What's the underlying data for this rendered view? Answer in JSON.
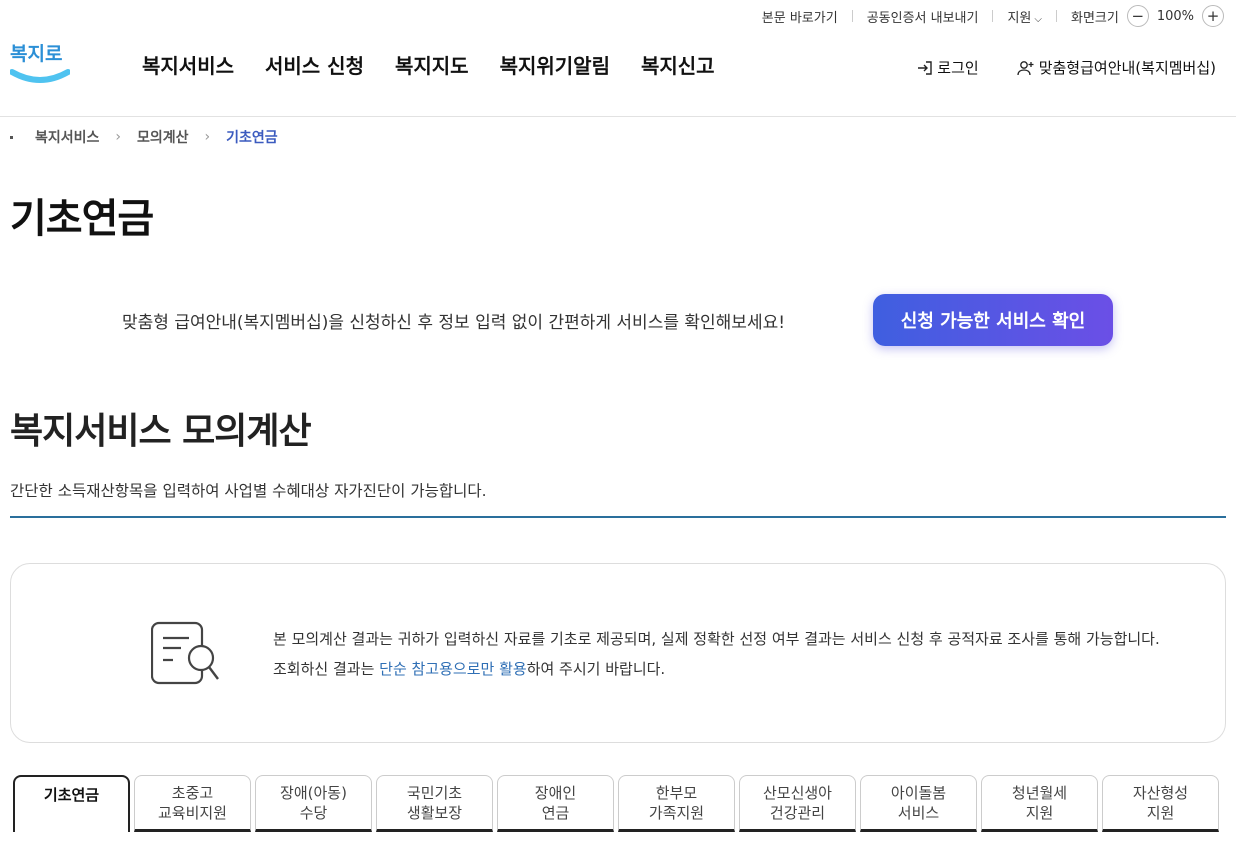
{
  "util": {
    "skip": "본문 바로가기",
    "cert_export": "공동인증서 내보내기",
    "support": "지원",
    "zoom_label": "화면크기",
    "zoom_value": "100%"
  },
  "logo_text": "복지로",
  "gnb": [
    "복지서비스",
    "서비스 신청",
    "복지지도",
    "복지위기알림",
    "복지신고"
  ],
  "header": {
    "login": "로그인",
    "membership": "맞춤형급여안내(복지멤버십)"
  },
  "breadcrumb": [
    "복지서비스",
    "모의계산",
    "기초연금"
  ],
  "page_title": "기초연금",
  "promo": {
    "text": "맞춤형 급여안내(복지멤버십)을 신청하신 후 정보 입력 없이 간편하게 서비스를 확인해보세요!",
    "button": "신청 가능한 서비스 확인"
  },
  "section": {
    "title": "복지서비스 모의계산",
    "desc": "간단한 소득재산항목을 입력하여 사업별 수혜대상 자가진단이 가능합니다."
  },
  "notice": {
    "part1": "본 모의계산 결과는 귀하가 입력하신 자료를 기초로 제공되며, 실제 정확한 선정 여부 결과는 서비스 신청 후 공적자료 조사를 통해 가능합니다. 조회하신 결과는 ",
    "highlight": "단순 참고용으로만 활용",
    "part2": "하여 주시기 바랍니다."
  },
  "tabs": [
    {
      "l1": "기초연금",
      "l2": ""
    },
    {
      "l1": "초중고",
      "l2": "교육비지원"
    },
    {
      "l1": "장애(아동)",
      "l2": "수당"
    },
    {
      "l1": "국민기초",
      "l2": "생활보장"
    },
    {
      "l1": "장애인",
      "l2": "연금"
    },
    {
      "l1": "한부모",
      "l2": "가족지원"
    },
    {
      "l1": "산모신생아",
      "l2": "건강관리"
    },
    {
      "l1": "아이돌봄",
      "l2": "서비스"
    },
    {
      "l1": "청년월세",
      "l2": "지원"
    },
    {
      "l1": "자산형성",
      "l2": "지원"
    }
  ],
  "colors": {
    "accent": "#3b5bbf",
    "rule": "#2a6f9c",
    "button_start": "#3f5fe0",
    "button_end": "#6b4fe6"
  }
}
